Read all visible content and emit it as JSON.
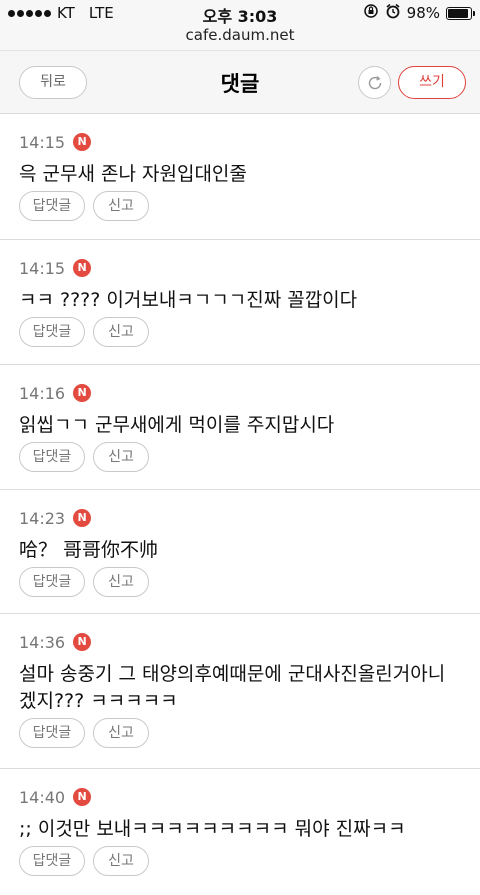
{
  "status_bar": {
    "carrier": "KT",
    "network": "LTE",
    "time": "오후 3:03",
    "battery": "98%",
    "icons": [
      "signal-dots-icon",
      "rotation-lock-icon",
      "alarm-icon",
      "battery-icon"
    ]
  },
  "browser": {
    "url": "cafe.daum.net"
  },
  "header": {
    "back_label": "뒤로",
    "title": "댓글",
    "refresh_icon": "refresh-icon",
    "write_label": "쓰기"
  },
  "colors": {
    "accent": "#e0423c",
    "badge": "#e34a40",
    "header_bg": "#f6f6f6"
  },
  "comments": [
    {
      "time": "14:15",
      "badge": "N",
      "text": "윽 군무새 존나 자원입대인줄",
      "reply_label": "답댓글",
      "report_label": "신고"
    },
    {
      "time": "14:15",
      "badge": "N",
      "text": "ㅋㅋ ???? 이거보내ㅋㄱㄱㄱ진짜 꼴깝이다",
      "reply_label": "답댓글",
      "report_label": "신고"
    },
    {
      "time": "14:16",
      "badge": "N",
      "text": "읽씹ㄱㄱ 군무새에게 먹이를 주지맙시다",
      "reply_label": "답댓글",
      "report_label": "신고"
    },
    {
      "time": "14:23",
      "badge": "N",
      "text": "哈？ 哥哥你不帅",
      "reply_label": "답댓글",
      "report_label": "신고"
    },
    {
      "time": "14:36",
      "badge": "N",
      "text": "설마 송중기 그 태양의후예때문에 군대사진올린거아니겠지??? ㅋㅋㅋㅋㅋ",
      "reply_label": "답댓글",
      "report_label": "신고"
    },
    {
      "time": "14:40",
      "badge": "N",
      "text": ";; 이것만 보내ㅋㅋㅋㅋㅋㅋㅋㅋㅋ 뭐야 진짜ㅋㅋ",
      "reply_label": "답댓글",
      "report_label": "신고"
    }
  ]
}
